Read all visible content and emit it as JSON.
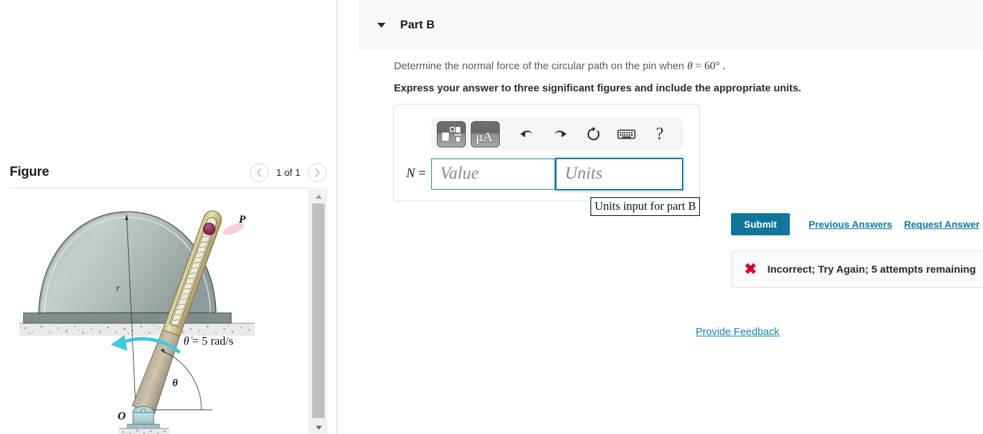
{
  "figure_panel": {
    "title": "Figure",
    "pager": {
      "prev_icon": "chevron-left-icon",
      "label": "1 of 1",
      "next_icon": "chevron-right-icon"
    },
    "scrollbar": {
      "up_icon": "triangle-up-icon",
      "down_icon": "triangle-down-icon"
    },
    "diagram": {
      "labels": {
        "pin": "P",
        "radius": "r",
        "angle": "θ",
        "pivot": "O",
        "angular_velocity": "θ̇ = 5 rad/s"
      },
      "colors": {
        "dome_light": "#c2cccb",
        "dome_dark": "#93a3a1",
        "dome_outline": "#3f4a4a",
        "rod_light": "#ded9a8",
        "rod_dark": "#b3a06b",
        "pin": "#8e2d52",
        "arrow": "#3fc8e0",
        "bracket": "#a9d3d6",
        "ground": "#bfbfbf"
      }
    }
  },
  "part": {
    "caret_icon": "triangle-down-icon",
    "title": "Part B",
    "question_prefix": "Determine the normal force of the circular path on the pin when ",
    "question_var": "θ",
    "question_eq": " = 60° .",
    "instruction": "Express your answer to three significant figures and include the appropriate units."
  },
  "answer": {
    "label_var": "N",
    "label_eq": " =",
    "value_placeholder": "Value",
    "units_placeholder": "Units",
    "value_text": "",
    "units_text": "",
    "tooltip": "Units input for part B",
    "toolbar": {
      "template_icon": "math-template-icon",
      "units_icon": "micro-angstrom-units-icon",
      "units_glyph": "μA",
      "undo_icon": "undo-arrow-icon",
      "redo_icon": "redo-arrow-icon",
      "reset_icon": "reset-circular-arrow-icon",
      "keyboard_icon": "keyboard-icon",
      "help_icon": "question-mark-icon",
      "help_glyph": "?"
    }
  },
  "actions": {
    "submit_label": "Submit",
    "previous_answers_label": "Previous Answers",
    "request_answer_label": "Request Answer"
  },
  "feedback": {
    "status_icon": "red-x-icon",
    "status_glyph": "✖",
    "status_text": "Incorrect; Try Again; 5 attempts remaining",
    "provide_feedback_label": "Provide Feedback"
  },
  "colors": {
    "accent": "#11759c",
    "link": "#1585ab",
    "error": "#d50032",
    "header_bg": "#f8f8f8",
    "focus_border": "#23749b"
  }
}
